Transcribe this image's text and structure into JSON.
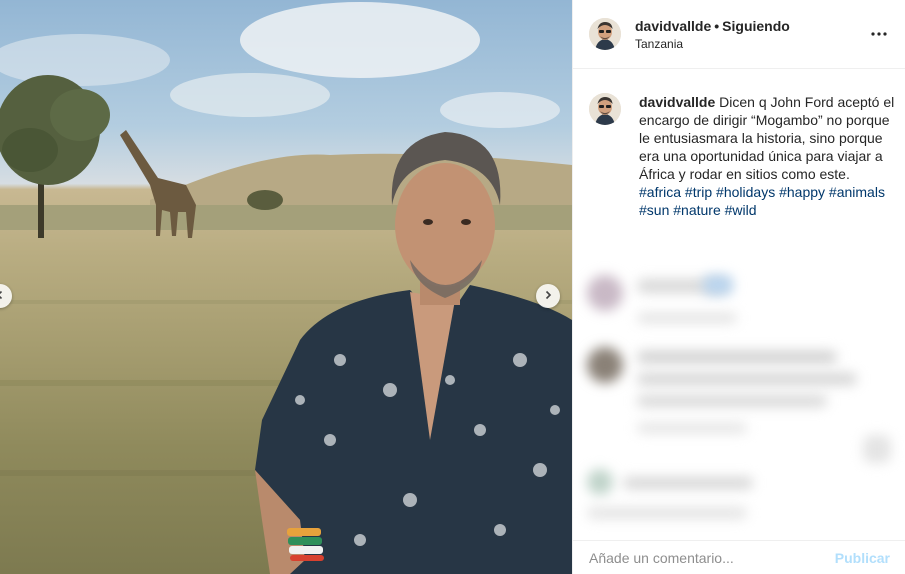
{
  "post": {
    "username": "davidvallde",
    "separator": "•",
    "follow_status": "Siguiendo",
    "location": "Tanzania",
    "more_icon": "more-horizontal-icon"
  },
  "caption": {
    "username": "davidvallde",
    "text": "Dicen q John Ford aceptó el encargo de dirigir “Mogambo” no porque le entusiasmara la historia, sino porque era una oportunidad única para viajar a África y rodar en sitios como este.",
    "hashtags": [
      "#africa",
      "#trip",
      "#holidays",
      "#happy",
      "#animals",
      "#sun",
      "#nature",
      "#wild"
    ]
  },
  "comment_box": {
    "placeholder": "Añade un comentario...",
    "post_label": "Publicar"
  },
  "carousel": {
    "prev_icon": "chevron-left-icon",
    "next_icon": "chevron-right-icon"
  }
}
